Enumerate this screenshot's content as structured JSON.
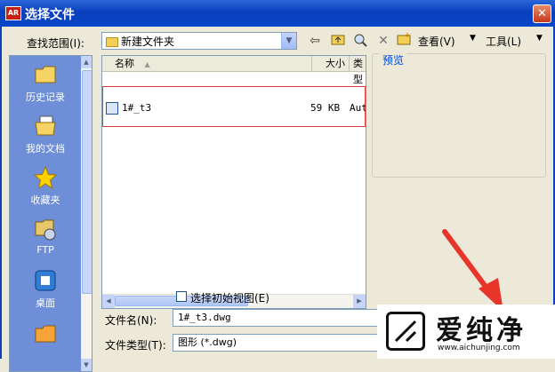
{
  "window": {
    "title": "选择文件",
    "app_icon_text": "AR",
    "close_glyph": "✕"
  },
  "toolbar": {
    "lookin_label": "查找范围(I):",
    "lookin_value": "新建文件夹",
    "views_label": "查看(V)",
    "tools_label": "工具(L)"
  },
  "places": [
    {
      "label": "历史记录",
      "icon": "folder-icon"
    },
    {
      "label": "我的文档",
      "icon": "document-folder-icon"
    },
    {
      "label": "收藏夹",
      "icon": "star-icon"
    },
    {
      "label": "FTP",
      "icon": "ftp-icon"
    },
    {
      "label": "桌面",
      "icon": "desktop-icon"
    }
  ],
  "filelist": {
    "columns": {
      "name": "名称",
      "size": "大小",
      "type": "类型"
    },
    "rows": [
      {
        "name": "1#_t3",
        "size": "59 KB",
        "type": "Aut"
      }
    ]
  },
  "preview": {
    "label": "预览"
  },
  "options": {
    "initial_view_label": "选择初始视图(E)",
    "initial_view_checked": false
  },
  "filename": {
    "label": "文件名(N):",
    "value": "1#_t3.dwg"
  },
  "filetype": {
    "label": "文件类型(T):",
    "value": "图形 (*.dwg)"
  },
  "watermark": {
    "title": "爱纯净",
    "url": "www.aichunjing.com"
  },
  "colors": {
    "titlebar": "#0a3fbd",
    "highlight_border": "#e04040",
    "annotation_arrow": "#e8352a"
  }
}
